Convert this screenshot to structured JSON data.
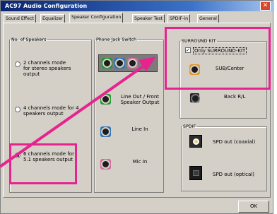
{
  "window": {
    "title": "AC97 Audio Configuration",
    "close_glyph": "✕"
  },
  "tabs": [
    {
      "label": "Sound Effect"
    },
    {
      "label": "Equalizer"
    },
    {
      "label": "Speaker Configuration"
    },
    {
      "label": "Speaker Test"
    },
    {
      "label": "SPDIF-in"
    },
    {
      "label": "General"
    }
  ],
  "speakers_group": {
    "title": "No. of Speakers",
    "options": [
      {
        "label": "2 channels mode for stereo speakers output",
        "selected": false
      },
      {
        "label": "4 channels mode for 4 speakers output",
        "selected": false
      },
      {
        "label": "6 channels mode for 5.1 speakers output",
        "selected": true
      }
    ]
  },
  "jack_group": {
    "title": "Phone Jack Switch",
    "jacks": [
      {
        "label": "Line Out / Front Speaker Output",
        "color": "#1d9a2a"
      },
      {
        "label": "Line In",
        "color": "#2c74b8"
      },
      {
        "label": "Mic In",
        "color": "#d36a9a"
      }
    ]
  },
  "surround_group": {
    "title": "SURROUND KIT",
    "checkbox_label": "Only SURROUND-KIT",
    "checked": true,
    "items": [
      {
        "label": "SUB/Center",
        "color": "#e2962a"
      },
      {
        "label": "Back R/L",
        "color": "#222222"
      }
    ]
  },
  "spdif_group": {
    "title": "SPDIF",
    "items": [
      {
        "label": "SPD out (coaxial)"
      },
      {
        "label": "SPD out (optical)"
      }
    ]
  },
  "ok_button": {
    "label": "OK"
  },
  "colors": {
    "highlight": "#e6238f",
    "title_bar": "#0a2472",
    "face": "#d4d0c8"
  }
}
